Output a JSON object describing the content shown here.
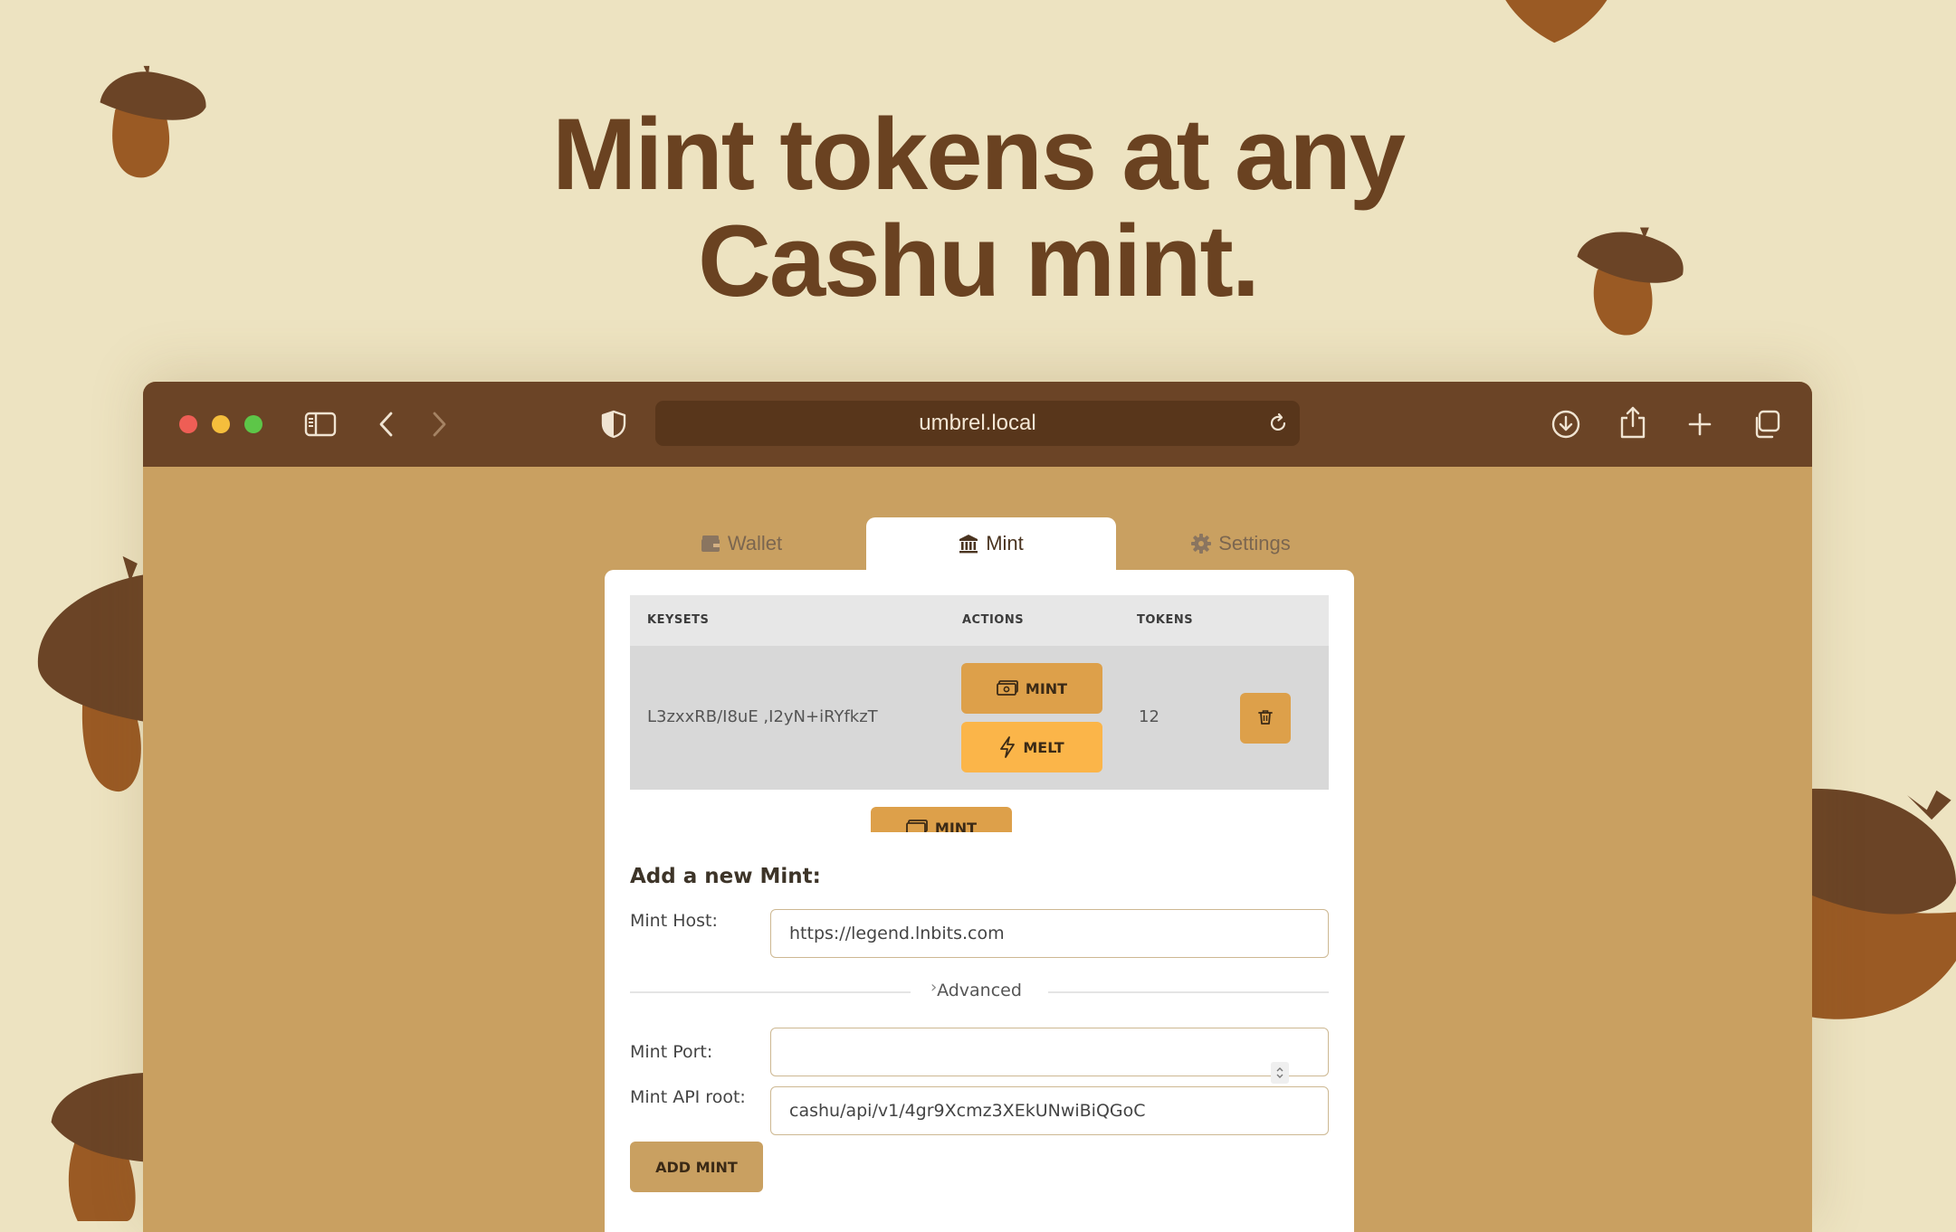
{
  "headline": {
    "line1": "Mint tokens at any",
    "line2": "Cashu mint."
  },
  "colors": {
    "background": "#ede3c1",
    "headline": "#6a4221",
    "browser_chrome": "#6b4426",
    "page": "#c9a061",
    "mint_button": "#dda04a",
    "melt_button": "#fbb549"
  },
  "browser": {
    "url": "umbrel.local",
    "icons": [
      "sidebar-icon",
      "back-icon",
      "forward-icon",
      "shield-icon",
      "reload-icon",
      "download-icon",
      "share-icon",
      "new-tab-icon",
      "tabs-overview-icon"
    ]
  },
  "tabs": [
    {
      "label": "Wallet",
      "icon": "wallet-icon",
      "active": false
    },
    {
      "label": "Mint",
      "icon": "bank-icon",
      "active": true
    },
    {
      "label": "Settings",
      "icon": "gear-icon",
      "active": false
    }
  ],
  "table": {
    "headers": {
      "keysets": "KEYSETS",
      "actions": "ACTIONS",
      "tokens": "TOKENS"
    },
    "rows": [
      {
        "keyset": "L3zxxRB/I8uE ,I2yN+iRYfkzT",
        "mint_label": "MINT",
        "melt_label": "MELT",
        "tokens": "12"
      }
    ],
    "partial_row": {
      "mint_label": "MINT"
    }
  },
  "form": {
    "title": "Add a new Mint:",
    "mint_host_label": "Mint Host:",
    "mint_host_value": "https://legend.lnbits.com",
    "advanced_label": "Advanced",
    "mint_port_label": "Mint Port:",
    "mint_port_value": "",
    "mint_api_root_label": "Mint API root:",
    "mint_api_root_value": "cashu/api/v1/4gr9Xcmz3XEkUNwiBiQGoC",
    "submit_label": "ADD MINT"
  }
}
